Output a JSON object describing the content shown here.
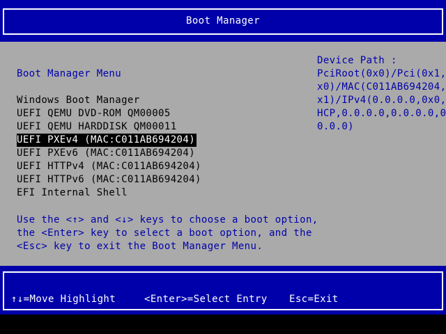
{
  "header": {
    "title": "Boot Manager"
  },
  "menu": {
    "heading": "Boot Manager Menu",
    "entries": [
      "Windows Boot Manager",
      "UEFI QEMU DVD-ROM QM00005",
      "UEFI QEMU HARDDISK QM00011",
      "UEFI PXEv4 (MAC:C011AB694204)",
      "UEFI PXEv6 (MAC:C011AB694204)",
      "UEFI HTTPv4 (MAC:C011AB694204)",
      "UEFI HTTPv6 (MAC:C011AB694204)",
      "EFI Internal Shell"
    ],
    "selected_index": 3
  },
  "help": {
    "lines": [
      "Use the <↑> and <↓> keys to choose a boot option,",
      "the <Enter> key to select a boot option, and the",
      "<Esc> key to exit the Boot Manager Menu."
    ]
  },
  "device_path": {
    "label": "Device Path :",
    "lines": [
      "PciRoot(0x0)/Pci(0x1,0",
      "x0)/MAC(C011AB694204,0",
      "x1)/IPv4(0.0.0.0,0x0,D",
      "HCP,0.0.0.0,0.0.0.0,0.",
      "0.0.0)"
    ]
  },
  "footer": {
    "move": "↑↓=Move Highlight",
    "select": "<Enter>=Select Entry",
    "exit": "Esc=Exit"
  },
  "colors": {
    "bar_blue": "#0000aa",
    "panel_gray": "#aaaaaa",
    "highlight_bg": "#000000",
    "highlight_fg": "#ffffff"
  }
}
